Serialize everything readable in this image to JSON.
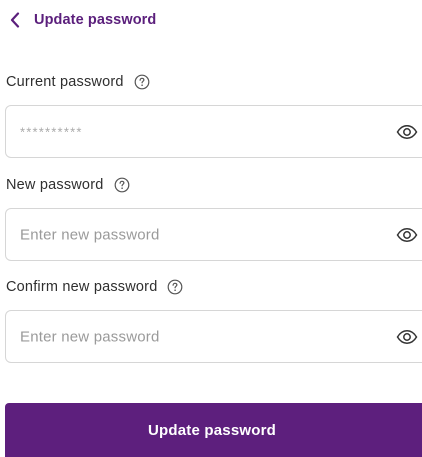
{
  "header": {
    "title": "Update password",
    "back_icon": "chevron-left-icon"
  },
  "fields": {
    "current": {
      "label": "Current password",
      "value": "**********",
      "help_icon": "question-circle-icon",
      "toggle_icon": "eye-icon"
    },
    "new": {
      "label": "New password",
      "placeholder": "Enter new password",
      "help_icon": "question-circle-icon",
      "toggle_icon": "eye-icon"
    },
    "confirm": {
      "label": "Confirm new password",
      "placeholder": "Enter new password",
      "help_icon": "question-circle-icon",
      "toggle_icon": "eye-icon"
    }
  },
  "submit": {
    "label": "Update password"
  },
  "colors": {
    "brand": "#5d1f7d",
    "border": "#d6d6d6",
    "placeholder": "#9a9a9a"
  }
}
